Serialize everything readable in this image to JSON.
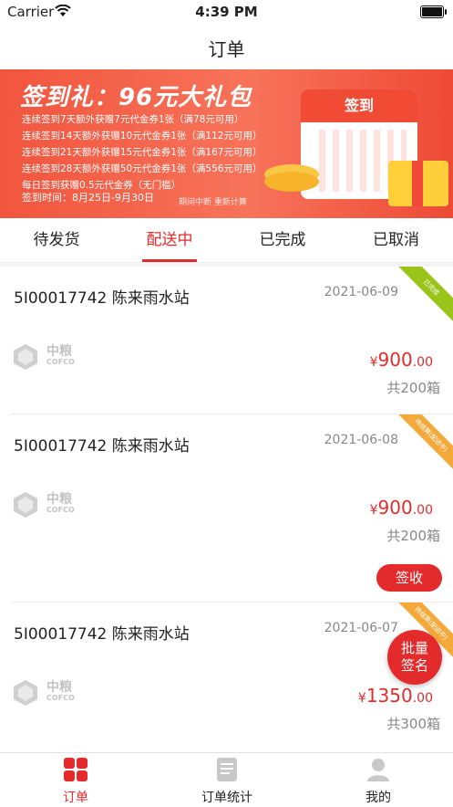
{
  "status_bar": {
    "carrier": "Carrier",
    "time": "4:39 PM"
  },
  "nav": {
    "title": "订单"
  },
  "banner": {
    "title": "签到礼：96元大礼包",
    "lines": [
      "连续签到7天额外获赠7元代金券1张（满78元可用）",
      "连续签到14天额外获赠10元代金券1张（满112元可用）",
      "连续签到21天额外获赠15元代金券1张（满167元可用）",
      "连续签到28天额外获赠50元代金券1张（满556元可用）",
      "每日签到获赠0.5元代金券（无门槛）"
    ],
    "date": "签到时间：8月25日-9月30日",
    "calendar_label": "签到",
    "pager_text": "期间中断  重新计算"
  },
  "tabs": [
    {
      "label": "待发货",
      "active": false
    },
    {
      "label": "配送中",
      "active": true
    },
    {
      "label": "已完成",
      "active": false
    },
    {
      "label": "已取消",
      "active": false
    }
  ],
  "orders": [
    {
      "id": "5I00017742 陈来雨水站",
      "date": "2021-06-09",
      "logo_cn": "中粮",
      "logo_en": "COFCO",
      "price_sym": "¥",
      "price_int": "900",
      "price_dec": ".00",
      "qty": "共200箱",
      "ribbon": "已完成",
      "ribbon_color": "#9bc41a"
    },
    {
      "id": "5I00017742 陈来雨水站",
      "date": "2021-06-08",
      "logo_cn": "中粮",
      "logo_en": "COFCO",
      "price_sym": "¥",
      "price_int": "900",
      "price_dec": ".00",
      "qty": "共200箱",
      "ribbon": "待结算(配送中)",
      "ribbon_color": "#f4a93b",
      "action": "签收"
    },
    {
      "id": "5I00017742 陈来雨水站",
      "date": "2021-06-07",
      "logo_cn": "中粮",
      "logo_en": "COFCO",
      "price_sym": "¥",
      "price_int": "1350",
      "price_dec": ".00",
      "qty": "共300箱",
      "ribbon": "待结算(配送中)",
      "ribbon_color": "#f4a93b"
    }
  ],
  "fab": {
    "line1": "批量",
    "line2": "签名"
  },
  "tabbar": [
    {
      "label": "订单",
      "icon": "grid-icon",
      "active": true
    },
    {
      "label": "订单统计",
      "icon": "document-icon",
      "active": false
    },
    {
      "label": "我的",
      "icon": "person-icon",
      "active": false
    }
  ],
  "colors": {
    "accent": "#e42b2b",
    "banner": "#f2553e",
    "ribbon_green": "#9bc41a",
    "ribbon_orange": "#f4a93b"
  }
}
